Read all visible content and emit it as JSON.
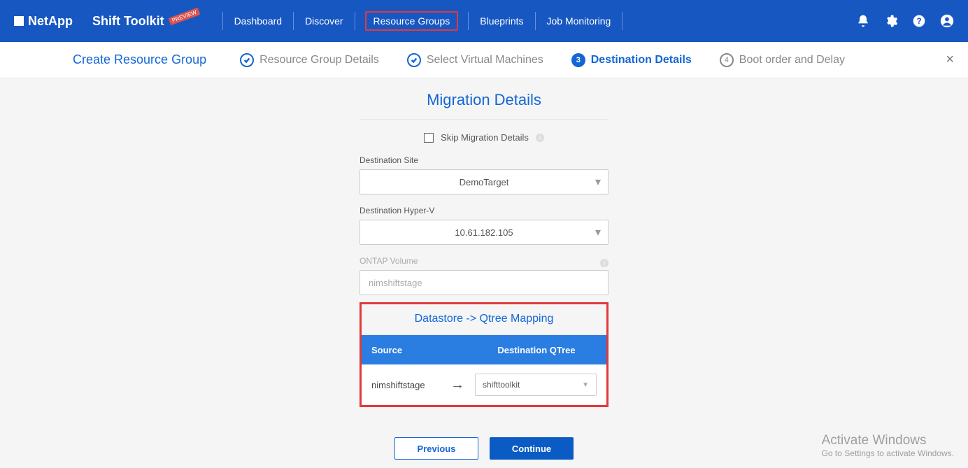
{
  "header": {
    "brand": "NetApp",
    "product": "Shift Toolkit",
    "badge": "PREVIEW",
    "nav": {
      "dashboard": "Dashboard",
      "discover": "Discover",
      "resource_groups": "Resource Groups",
      "blueprints": "Blueprints",
      "job_monitoring": "Job Monitoring"
    }
  },
  "wizard": {
    "title": "Create Resource Group",
    "steps": {
      "s1": "Resource Group Details",
      "s2": "Select Virtual Machines",
      "s3": "Destination Details",
      "s4": "Boot order and Delay",
      "s3num": "3",
      "s4num": "4"
    }
  },
  "main": {
    "title": "Migration Details",
    "skip_label": "Skip Migration Details",
    "fields": {
      "dest_site_label": "Destination Site",
      "dest_site_value": "DemoTarget",
      "hyperv_label": "Destination Hyper-V",
      "hyperv_value": "10.61.182.105",
      "ontap_label": "ONTAP Volume",
      "ontap_value": "nimshiftstage"
    },
    "mapping": {
      "title": "Datastore -> Qtree Mapping",
      "col_source": "Source",
      "col_dest": "Destination QTree",
      "row_source": "nimshiftstage",
      "row_dest": "shifttoolkit"
    }
  },
  "buttons": {
    "prev": "Previous",
    "cont": "Continue"
  },
  "watermark": {
    "l1": "Activate Windows",
    "l2": "Go to Settings to activate Windows."
  }
}
